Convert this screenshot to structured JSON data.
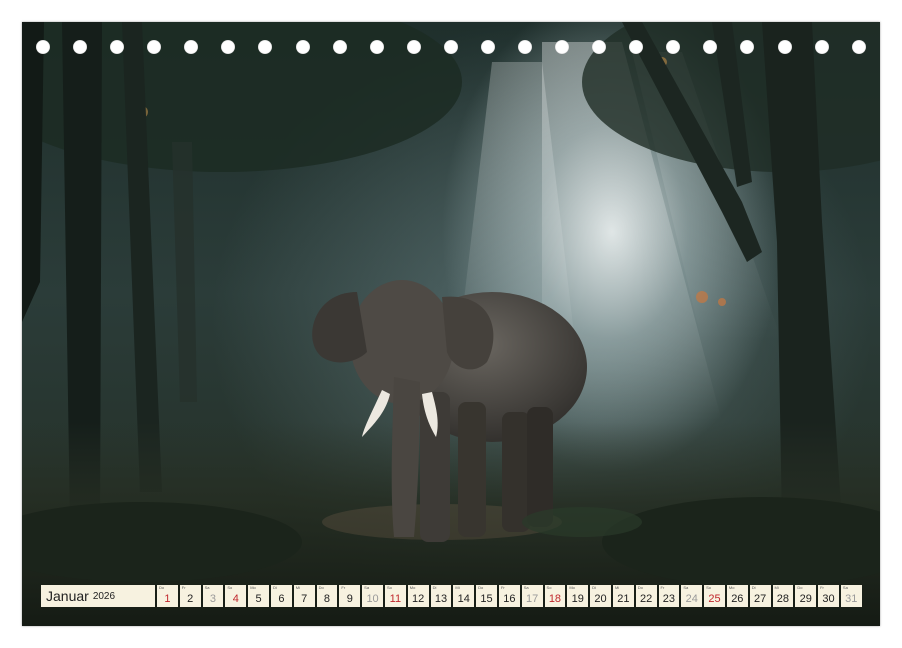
{
  "calendar": {
    "month": "Januar",
    "year": "2026",
    "days": [
      {
        "n": "1",
        "dow": "Do",
        "type": "sun"
      },
      {
        "n": "2",
        "dow": "Fr",
        "type": "work"
      },
      {
        "n": "3",
        "dow": "Sa",
        "type": "sat"
      },
      {
        "n": "4",
        "dow": "So",
        "type": "sun"
      },
      {
        "n": "5",
        "dow": "Mo",
        "type": "work"
      },
      {
        "n": "6",
        "dow": "Di",
        "type": "work"
      },
      {
        "n": "7",
        "dow": "Mi",
        "type": "work"
      },
      {
        "n": "8",
        "dow": "Do",
        "type": "work"
      },
      {
        "n": "9",
        "dow": "Fr",
        "type": "work"
      },
      {
        "n": "10",
        "dow": "Sa",
        "type": "sat"
      },
      {
        "n": "11",
        "dow": "So",
        "type": "sun"
      },
      {
        "n": "12",
        "dow": "Mo",
        "type": "work"
      },
      {
        "n": "13",
        "dow": "Di",
        "type": "work"
      },
      {
        "n": "14",
        "dow": "Mi",
        "type": "work"
      },
      {
        "n": "15",
        "dow": "Do",
        "type": "work"
      },
      {
        "n": "16",
        "dow": "Fr",
        "type": "work"
      },
      {
        "n": "17",
        "dow": "Sa",
        "type": "sat"
      },
      {
        "n": "18",
        "dow": "So",
        "type": "sun"
      },
      {
        "n": "19",
        "dow": "Mo",
        "type": "work"
      },
      {
        "n": "20",
        "dow": "Di",
        "type": "work"
      },
      {
        "n": "21",
        "dow": "Mi",
        "type": "work"
      },
      {
        "n": "22",
        "dow": "Do",
        "type": "work"
      },
      {
        "n": "23",
        "dow": "Fr",
        "type": "work"
      },
      {
        "n": "24",
        "dow": "Sa",
        "type": "sat"
      },
      {
        "n": "25",
        "dow": "So",
        "type": "sun"
      },
      {
        "n": "26",
        "dow": "Mo",
        "type": "work"
      },
      {
        "n": "27",
        "dow": "Di",
        "type": "work"
      },
      {
        "n": "28",
        "dow": "Mi",
        "type": "work"
      },
      {
        "n": "29",
        "dow": "Do",
        "type": "work"
      },
      {
        "n": "30",
        "dow": "Fr",
        "type": "work"
      },
      {
        "n": "31",
        "dow": "Sa",
        "type": "sat"
      }
    ]
  },
  "binding": {
    "hole_count": 23
  },
  "image": {
    "subject_icon": "elephant-in-forest-photo"
  }
}
